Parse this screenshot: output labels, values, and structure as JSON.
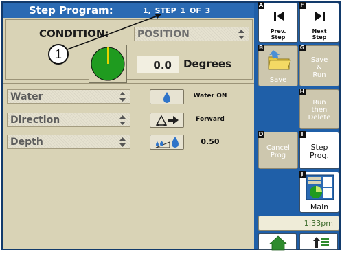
{
  "header": {
    "title": "Step Program:",
    "step_info": "1, STEP  1  OF  3"
  },
  "condition": {
    "label": "CONDITION:",
    "value": "POSITION",
    "degrees_value": "0.0",
    "degrees_label": "Degrees"
  },
  "callout": {
    "number": "1"
  },
  "rows": [
    {
      "label": "Water",
      "icon": "water-drop-icon",
      "info": "Water ON"
    },
    {
      "label": "Direction",
      "icon": "direction-arrow-icon",
      "info": "Forward"
    },
    {
      "label": "Depth",
      "icon": "depth-ramp-icon",
      "info": "0.50"
    }
  ],
  "buttons": {
    "prev_step": {
      "key": "A",
      "label_1": "Prev.",
      "label_2": "Step"
    },
    "next_step": {
      "key": "F",
      "label_1": "Next",
      "label_2": "Step"
    },
    "save": {
      "key": "B",
      "label": "Save"
    },
    "save_run": {
      "key": "G",
      "label_1": "Save",
      "label_2": "&",
      "label_3": "Run"
    },
    "run_then_delete": {
      "key": "H",
      "label_1": "Run",
      "label_2": "then",
      "label_3": "Delete"
    },
    "cancel_prog": {
      "key": "D",
      "label_1": "Cancel",
      "label_2": "Prog"
    },
    "step_prog": {
      "key": "I",
      "label_1": "Step",
      "label_2": "Prog."
    },
    "main": {
      "key": "J",
      "label": "Main"
    }
  },
  "time": "1:33pm",
  "colors": {
    "frame_blue": "#1f5fa8",
    "title_blue": "#2a6ab3",
    "panel_tan": "#d9d3b6",
    "gauge_green": "#1f9b1f",
    "needle_yellow": "#e6d200",
    "time_green": "#3d6b2c"
  },
  "icons": {
    "home": "home-icon",
    "up_menu": "up-arrow-menu-icon"
  }
}
